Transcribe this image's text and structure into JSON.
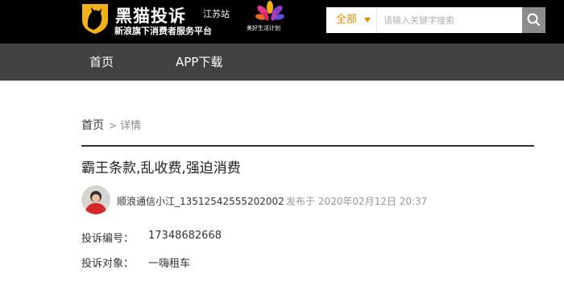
{
  "header": {
    "brand_title": "黑猫投诉",
    "brand_slogan": "新浪旗下消费者服务平台",
    "site_location": "江苏站",
    "flower_text": "美好生活计划",
    "search": {
      "category": "全部",
      "placeholder": "请输入关键字搜索"
    }
  },
  "nav": {
    "items": [
      {
        "label": "首页"
      },
      {
        "label": "APP下载"
      }
    ]
  },
  "breadcrumb": {
    "home": "首页",
    "separator": ">",
    "current": "详情"
  },
  "complaint": {
    "title": "霸王条款,乱收费,强迫消费",
    "author": "顺浪通信小江_1351254255520200​2",
    "published": "发布于 2020年02月12日 20:37",
    "fields": [
      {
        "label": "投诉编号：",
        "value": "17348682668"
      },
      {
        "label": "投诉对象：",
        "value": "一嗨租车"
      }
    ]
  },
  "colors": {
    "header_bg": "#000000",
    "nav_bg": "#424242",
    "accent": "#f08a00",
    "logo_yellow": "#f2b11b"
  }
}
